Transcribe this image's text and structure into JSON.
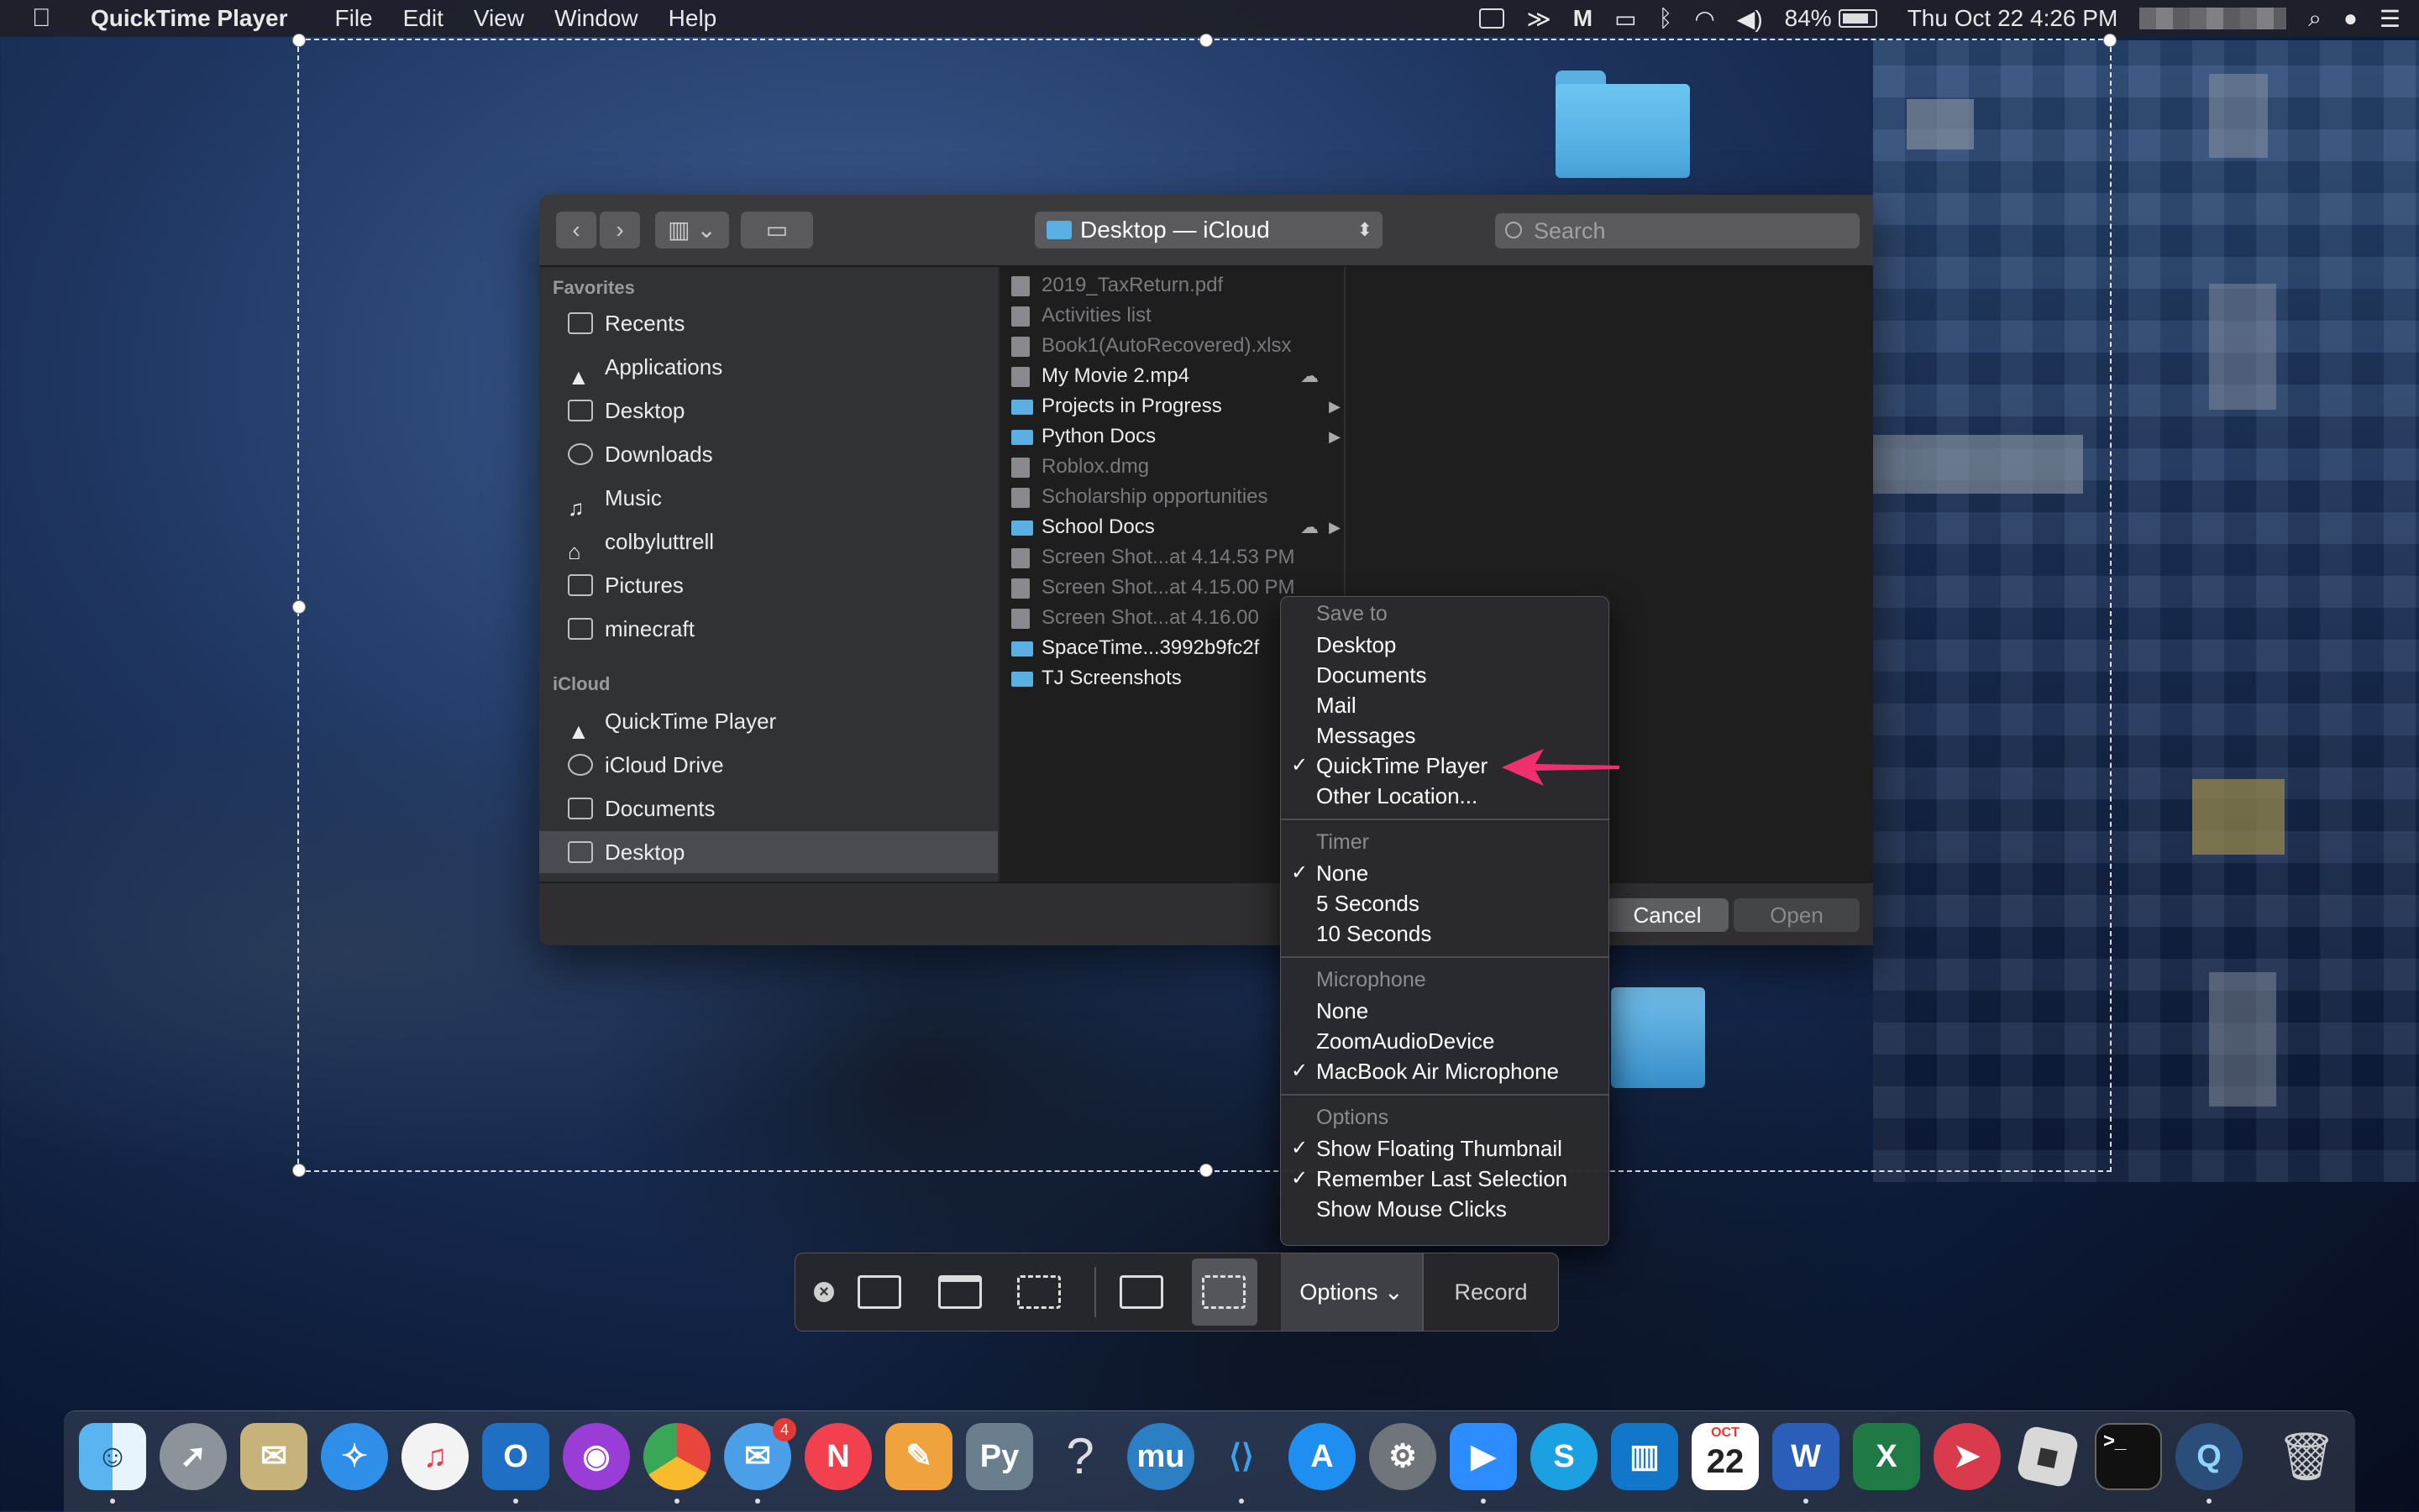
{
  "menubar": {
    "apple_icon": "apple-icon",
    "app_name": "QuickTime Player",
    "menus": [
      "File",
      "Edit",
      "View",
      "Window",
      "Help"
    ],
    "battery": "84%",
    "clock": "Thu Oct 22  4:26 PM"
  },
  "dialog": {
    "path_label": "Desktop — iCloud",
    "search_placeholder": "Search",
    "sidebar": {
      "favorites_heading": "Favorites",
      "favorites": [
        "Recents",
        "Applications",
        "Desktop",
        "Downloads",
        "Music",
        "colbyluttrell",
        "Pictures",
        "minecraft"
      ],
      "icloud_heading": "iCloud",
      "icloud": [
        "QuickTime Player",
        "iCloud Drive",
        "Documents",
        "Desktop"
      ]
    },
    "files": [
      {
        "name": "2019_TaxReturn.pdf",
        "kind": "doc",
        "dim": true
      },
      {
        "name": "Activities list",
        "kind": "doc",
        "dim": true
      },
      {
        "name": "Book1(AutoRecovered).xlsx",
        "kind": "doc",
        "dim": true
      },
      {
        "name": "My Movie 2.mp4",
        "kind": "doc",
        "dim": false,
        "cloud": true
      },
      {
        "name": "Projects in Progress",
        "kind": "folder",
        "dim": false,
        "arrow": true
      },
      {
        "name": "Python Docs",
        "kind": "folder",
        "dim": false,
        "arrow": true
      },
      {
        "name": "Roblox.dmg",
        "kind": "doc",
        "dim": true
      },
      {
        "name": "Scholarship opportunities",
        "kind": "doc",
        "dim": true
      },
      {
        "name": "School Docs",
        "kind": "folder",
        "dim": false,
        "arrow": true,
        "cloud": true
      },
      {
        "name": "Screen Shot...at 4.14.53 PM",
        "kind": "doc",
        "dim": true
      },
      {
        "name": "Screen Shot...at 4.15.00 PM",
        "kind": "doc",
        "dim": true
      },
      {
        "name": "Screen Shot...at 4.16.00",
        "kind": "doc",
        "dim": true
      },
      {
        "name": "SpaceTime...3992b9fc2f",
        "kind": "folder",
        "dim": false
      },
      {
        "name": "TJ Screenshots",
        "kind": "folder",
        "dim": false
      }
    ],
    "cancel_label": "Cancel",
    "open_label": "Open"
  },
  "options_menu": {
    "save_to_heading": "Save to",
    "save_to": [
      {
        "label": "Desktop",
        "checked": false
      },
      {
        "label": "Documents",
        "checked": false
      },
      {
        "label": "Mail",
        "checked": false
      },
      {
        "label": "Messages",
        "checked": false
      },
      {
        "label": "QuickTime Player",
        "checked": true
      },
      {
        "label": "Other Location...",
        "checked": false
      }
    ],
    "timer_heading": "Timer",
    "timer": [
      {
        "label": "None",
        "checked": true
      },
      {
        "label": "5 Seconds",
        "checked": false
      },
      {
        "label": "10 Seconds",
        "checked": false
      }
    ],
    "microphone_heading": "Microphone",
    "microphone": [
      {
        "label": "None",
        "checked": false
      },
      {
        "label": "ZoomAudioDevice",
        "checked": false
      },
      {
        "label": "MacBook Air Microphone",
        "checked": true
      }
    ],
    "options_heading": "Options",
    "options": [
      {
        "label": "Show Floating Thumbnail",
        "checked": true
      },
      {
        "label": "Remember Last Selection",
        "checked": true
      },
      {
        "label": "Show Mouse Clicks",
        "checked": false
      }
    ],
    "check_glyph": "✓",
    "arrow_color": "#f0306e"
  },
  "capture_bar": {
    "options_label": "Options",
    "record_label": "Record"
  },
  "dock": {
    "messages_badge": "4",
    "calendar_month": "OCT",
    "calendar_day": "22"
  }
}
